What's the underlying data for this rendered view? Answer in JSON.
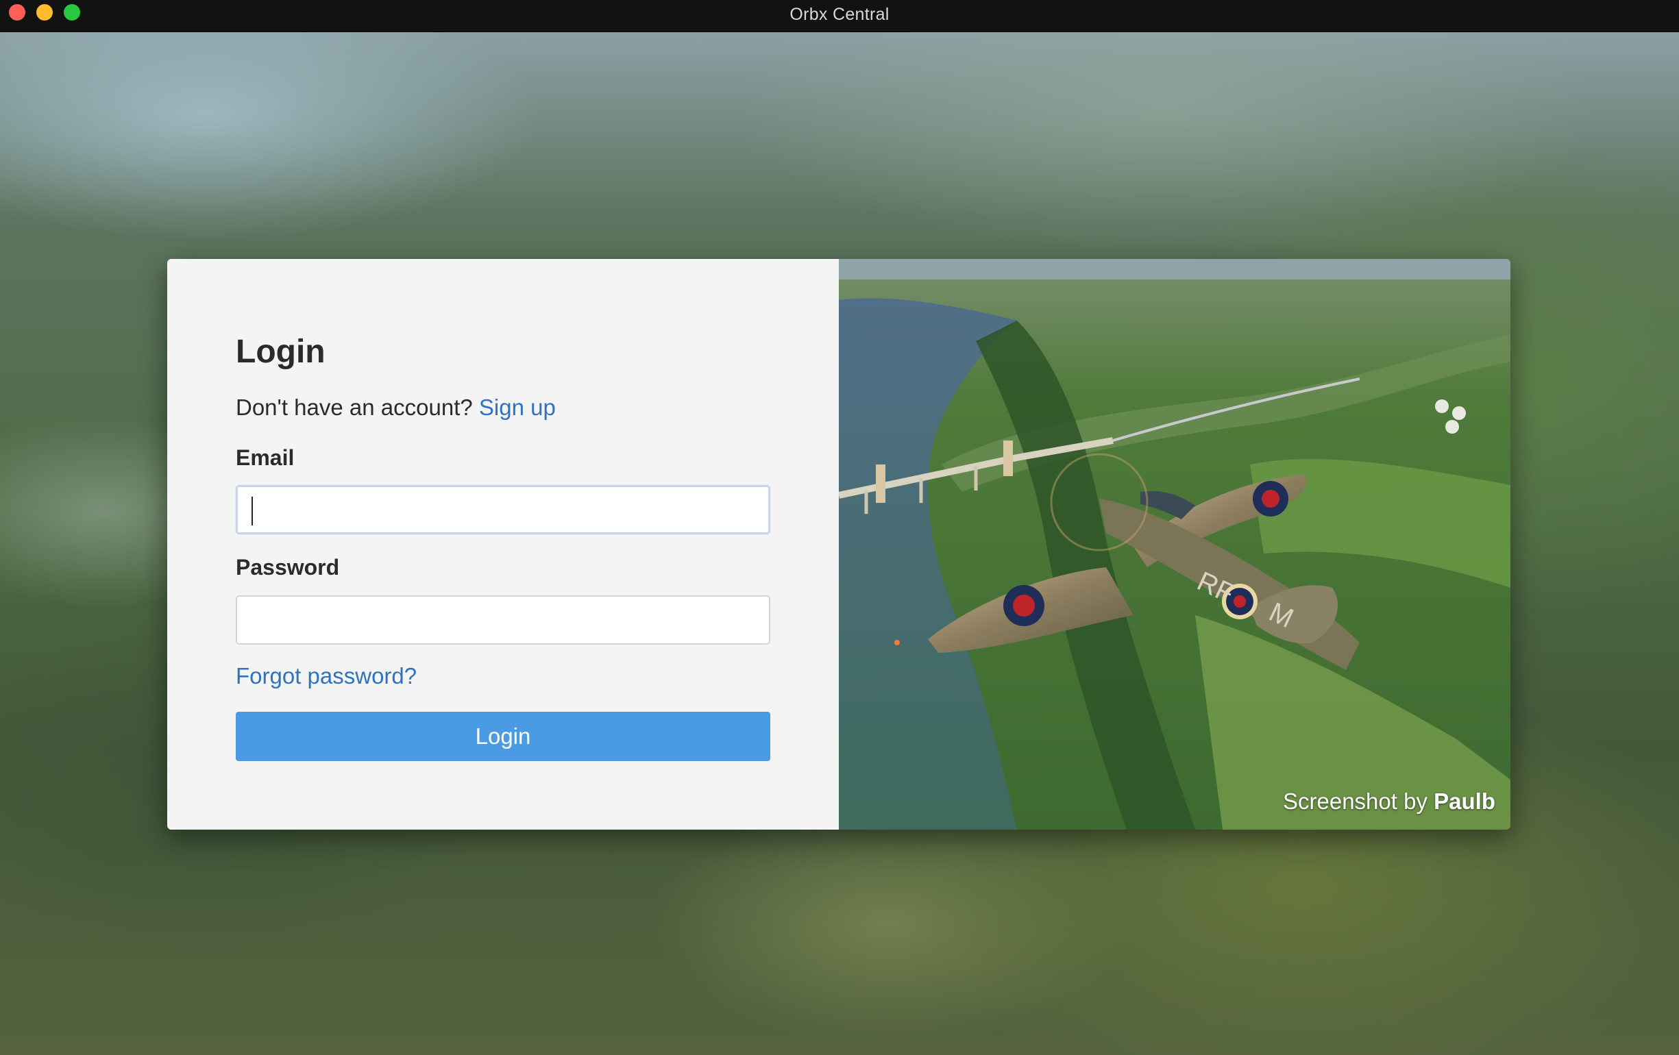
{
  "window": {
    "title": "Orbx Central"
  },
  "login": {
    "title": "Login",
    "no_account_text": "Don't have an account?",
    "signup_link": "Sign up",
    "email_label": "Email",
    "email_value": "",
    "password_label": "Password",
    "password_value": "",
    "forgot_password": "Forgot password?",
    "login_button": "Login"
  },
  "hero": {
    "credit_prefix": "Screenshot by",
    "credit_author": "Paulb",
    "plane_marking": "RF M"
  },
  "colors": {
    "accent_button": "#4a9be4",
    "link": "#2f73c0",
    "form_background": "#f4f4f4"
  }
}
